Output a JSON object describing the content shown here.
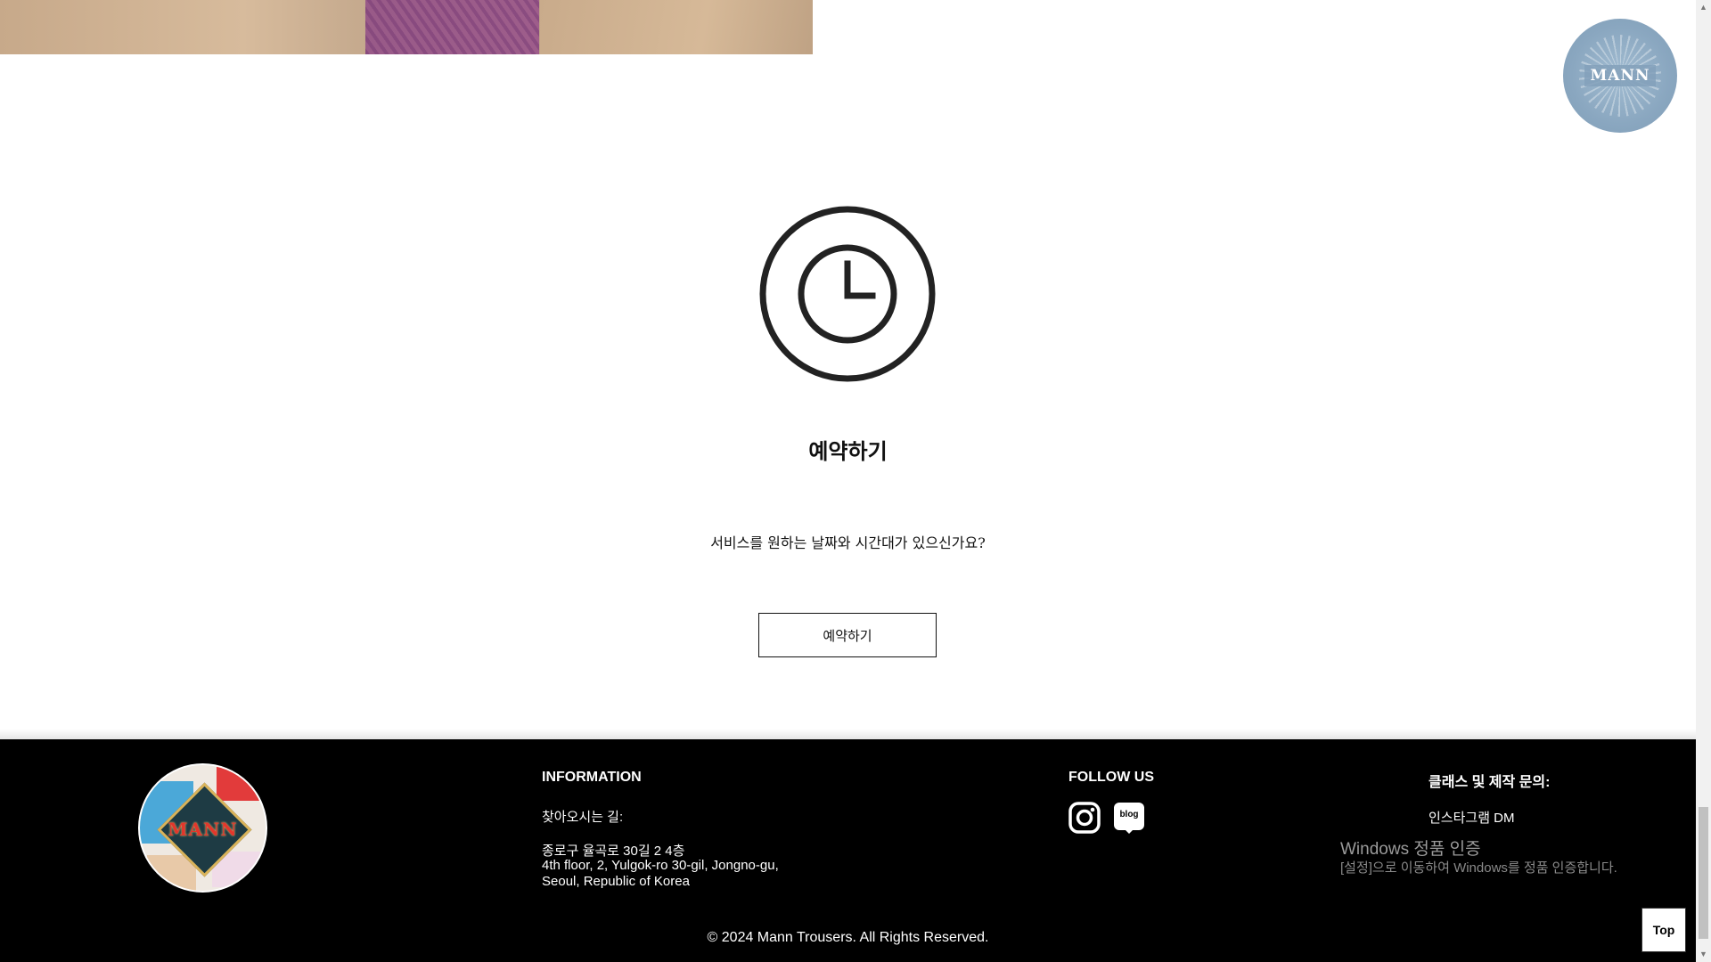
{
  "floating_logo": {
    "label": "MANN"
  },
  "booking": {
    "title": "예약하기",
    "description": "서비스를 원하는 날짜와 시간대가 있으신가요?",
    "button_label": "예약하기"
  },
  "footer": {
    "logo_text": "MANN",
    "information": {
      "title": "INFORMATION",
      "directions_label": "찾아오시는 길:",
      "address_ko": "종로구 율곡로 30길 2 4층",
      "address_en_line1": "4th floor, 2, Yulgok-ro 30-gil, Jongno-gu,",
      "address_en_line2": "Seoul, Republic of Korea"
    },
    "follow": {
      "title": "FOLLOW US",
      "blog_icon_text": "blog"
    },
    "contact": {
      "title": "클래스 및 제작 문의:",
      "instagram_dm": "인스타그램 DM"
    },
    "copyright": "© 2024 Mann Trousers. All Rights Reserved."
  },
  "windows_watermark": {
    "title": "Windows 정품 인증",
    "text": "[설정]으로 이동하여 Windows를 정품 인증합니다."
  },
  "top_button": {
    "label": "Top"
  }
}
